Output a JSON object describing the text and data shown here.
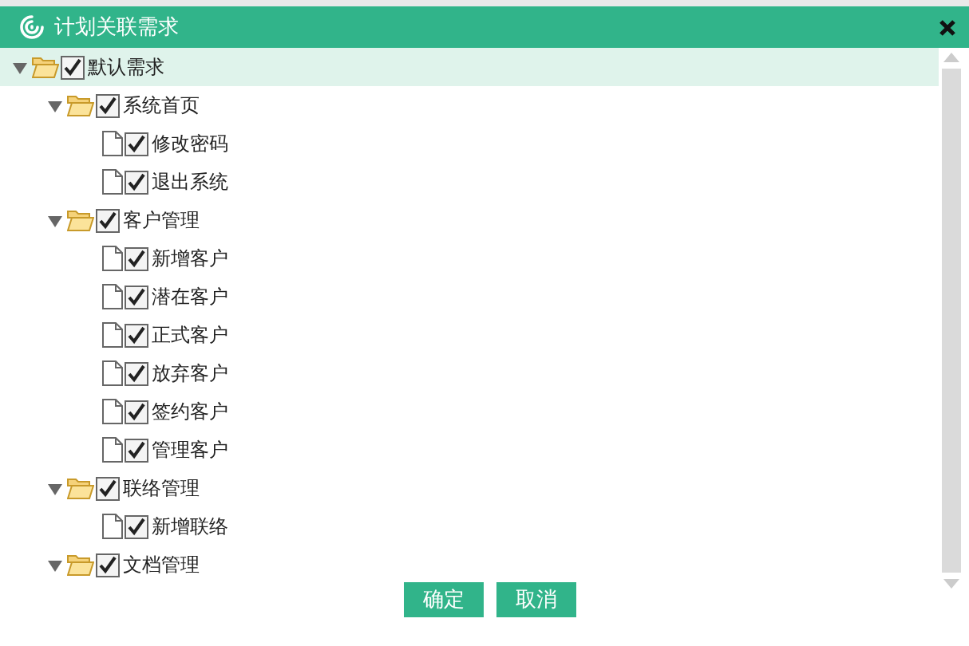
{
  "window": {
    "title": "计划关联需求"
  },
  "tree": [
    {
      "label": "默认需求",
      "checked": true,
      "expanded": true,
      "selected": true,
      "children": [
        {
          "label": "系统首页",
          "checked": true,
          "expanded": true,
          "selected": false,
          "children": [
            {
              "label": "修改密码",
              "checked": true,
              "selected": false
            },
            {
              "label": "退出系统",
              "checked": true,
              "selected": false
            }
          ]
        },
        {
          "label": "客户管理",
          "checked": true,
          "expanded": true,
          "selected": false,
          "children": [
            {
              "label": "新增客户",
              "checked": true,
              "selected": false
            },
            {
              "label": "潜在客户",
              "checked": true,
              "selected": false
            },
            {
              "label": "正式客户",
              "checked": true,
              "selected": false
            },
            {
              "label": "放弃客户",
              "checked": true,
              "selected": false
            },
            {
              "label": "签约客户",
              "checked": true,
              "selected": false
            },
            {
              "label": "管理客户",
              "checked": true,
              "selected": false
            }
          ]
        },
        {
          "label": "联络管理",
          "checked": true,
          "expanded": true,
          "selected": false,
          "children": [
            {
              "label": "新增联络",
              "checked": true,
              "selected": false
            }
          ]
        },
        {
          "label": "文档管理",
          "checked": true,
          "expanded": true,
          "selected": false
        }
      ]
    }
  ],
  "buttons": [
    "确定",
    "取消"
  ]
}
